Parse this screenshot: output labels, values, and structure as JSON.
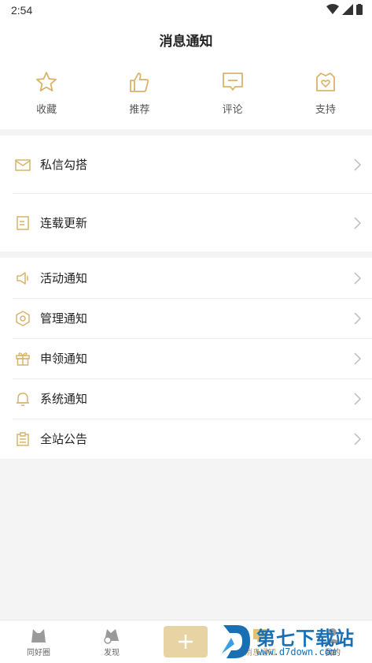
{
  "status": {
    "time": "2:54"
  },
  "header": {
    "title": "消息通知"
  },
  "quick_actions": [
    {
      "label": "收藏",
      "icon": "star-icon"
    },
    {
      "label": "推荐",
      "icon": "thumbs-up-icon"
    },
    {
      "label": "评论",
      "icon": "comment-icon"
    },
    {
      "label": "支持",
      "icon": "heart-gift-icon"
    }
  ],
  "group1": [
    {
      "label": "私信勾搭",
      "icon": "mail-icon"
    },
    {
      "label": "连载更新",
      "icon": "document-icon"
    }
  ],
  "group2": [
    {
      "label": "活动通知",
      "icon": "speaker-icon"
    },
    {
      "label": "管理通知",
      "icon": "hexagon-icon"
    },
    {
      "label": "申领通知",
      "icon": "gift-icon"
    },
    {
      "label": "系统通知",
      "icon": "bell-icon"
    },
    {
      "label": "全站公告",
      "icon": "clipboard-icon"
    }
  ],
  "tabs": [
    {
      "label": "同好圈"
    },
    {
      "label": "发现"
    },
    {
      "label": "消息通知"
    },
    {
      "label": "我的"
    }
  ],
  "watermark": {
    "title": "第七下载站",
    "url": "www.d7down.com"
  },
  "colors": {
    "accent": "#e2c27b",
    "icon_gold": "#d9b36a"
  }
}
